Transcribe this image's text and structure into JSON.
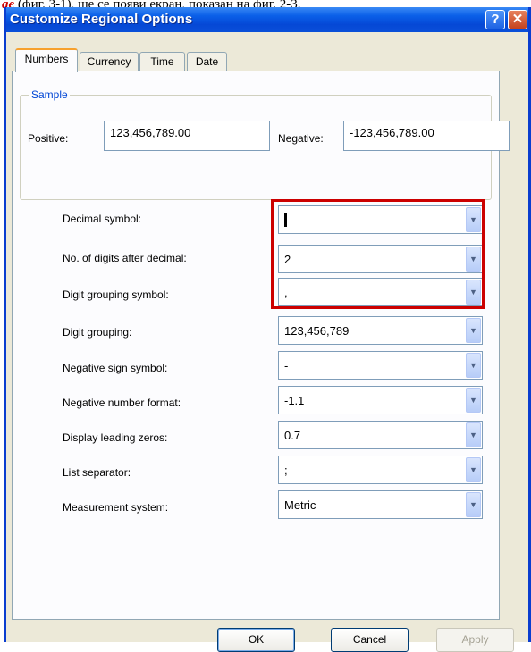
{
  "doc_text": {
    "red": "ge",
    "rest": " (фиг. 3-1), ще се появи екран, показан на фиг. 2-3."
  },
  "window": {
    "title": "Customize Regional Options",
    "help_glyph": "?",
    "close_glyph": "✕"
  },
  "tabs": [
    {
      "label": "Numbers",
      "active": true
    },
    {
      "label": "Currency",
      "active": false
    },
    {
      "label": "Time",
      "active": false
    },
    {
      "label": "Date",
      "active": false
    }
  ],
  "sample": {
    "group_label": "Sample",
    "positive_label": "Positive:",
    "positive_value": "123,456,789.00",
    "negative_label": "Negative:",
    "negative_value": "-123,456,789.00"
  },
  "settings": [
    {
      "label": "Decimal symbol:",
      "value": ""
    },
    {
      "label": "No. of digits after decimal:",
      "value": "2"
    },
    {
      "label": "Digit grouping symbol:",
      "value": ","
    },
    {
      "label": "Digit grouping:",
      "value": "123,456,789"
    },
    {
      "label": "Negative sign symbol:",
      "value": "-"
    },
    {
      "label": "Negative number format:",
      "value": "-1.1"
    },
    {
      "label": "Display leading zeros:",
      "value": "0.7"
    },
    {
      "label": "List separator:",
      "value": ";"
    },
    {
      "label": "Measurement system:",
      "value": "Metric"
    }
  ],
  "dropdown_icon": "chevron-down-icon",
  "buttons": {
    "ok": "OK",
    "cancel": "Cancel",
    "apply": "Apply"
  },
  "colors": {
    "titlebar": "#0548d6",
    "highlight": "#cc0000",
    "tab_accent": "#f7a12e",
    "group_label": "#0046d5"
  }
}
